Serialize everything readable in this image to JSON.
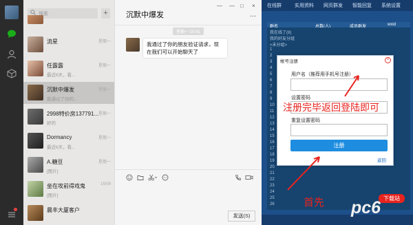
{
  "search": {
    "placeholder": "搜索",
    "icon": "search-icon"
  },
  "add_button": "+",
  "contacts": [
    {
      "name": "",
      "message": "",
      "time": ""
    },
    {
      "name": "流星",
      "message": "",
      "time": "星期一"
    },
    {
      "name": "任露露",
      "message": "最近6天，看...",
      "time": "星期一"
    },
    {
      "name": "沉默中爆发",
      "message": "我通过了你的...",
      "time": "星期一"
    },
    {
      "name": "2998特价房137791...",
      "message": "好的",
      "time": "星期一"
    },
    {
      "name": "Dormancy",
      "message": "最近6天，看...",
      "time": "星期一"
    },
    {
      "name": "A.糖豆",
      "message": "[图片]",
      "time": "星期一"
    },
    {
      "name": "坐在攻前得戏鬼",
      "message": "[图片]",
      "time": "15/09"
    },
    {
      "name": "晨丰大厦客户",
      "message": "",
      "time": ""
    }
  ],
  "chat": {
    "title": "沉默中爆发",
    "timestamp": "星期一 15:41",
    "message": "我通过了你的朋友验证请求，现在我们可以开始聊天了",
    "send_label": "发送(S)",
    "more_label": "..."
  },
  "window_controls": {
    "pin": "—",
    "minimize": "—",
    "maximize": "□",
    "close": "×"
  },
  "right_app": {
    "tabs": [
      "在线群",
      "实用资料",
      "网页群发",
      "智能回复",
      "系统设置"
    ],
    "header": [
      "群名",
      "总数(人)",
      "成员群发",
      "wxid"
    ],
    "rows": [
      "我在线了(8)",
      "我的好友分组",
      "<未分组>",
      "1",
      "2",
      "3",
      "4",
      "5",
      "6",
      "7",
      "8",
      "9",
      "10",
      "11",
      "12",
      "13",
      "14",
      "15",
      "16",
      "17",
      "18",
      "19",
      "20",
      "21",
      "22",
      "23",
      "24",
      "25",
      "26"
    ]
  },
  "register_dialog": {
    "title": "帐号注册",
    "close": "×",
    "username_label": "用户名（推荐用手机号注册）",
    "password_label": "设置密码",
    "repeat_label": "重复设置密码",
    "register_button": "注册",
    "login_link": "返回"
  },
  "annotation": {
    "text": "注册完毕返回登陆即可",
    "text2": "首先",
    "color": "#e8231e"
  },
  "watermark": {
    "logo": "pc6",
    "badge": "下载站"
  },
  "colors": {
    "wechat_green": "#1aad19",
    "register_blue": "#1e8de0",
    "annotation_red": "#e8231e",
    "app_blue": "#1d4f8a"
  }
}
